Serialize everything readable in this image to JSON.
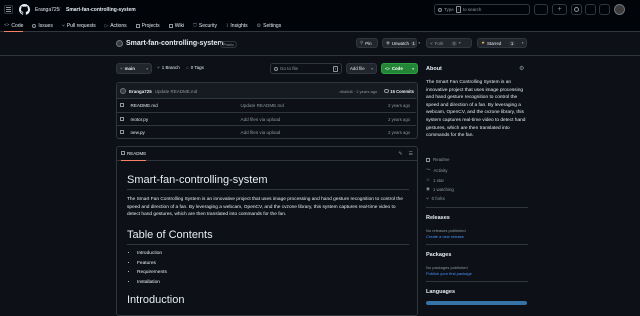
{
  "header": {
    "owner": "Eranga725",
    "separator": "/",
    "repo": "Smart-fan-controlling-system",
    "search_placeholder_prefix": "Type",
    "search_placeholder_key": "/",
    "search_placeholder_suffix": "to search"
  },
  "nav": {
    "tabs": [
      {
        "label": "Code"
      },
      {
        "label": "Issues"
      },
      {
        "label": "Pull requests"
      },
      {
        "label": "Actions"
      },
      {
        "label": "Projects"
      },
      {
        "label": "Wiki"
      },
      {
        "label": "Security"
      },
      {
        "label": "Insights"
      },
      {
        "label": "Settings"
      }
    ]
  },
  "repo": {
    "name": "Smart-fan-controlling-system",
    "visibility": "Public",
    "pin": "Pin",
    "unwatch": "Unwatch",
    "unwatch_count": "1",
    "fork": "Fork",
    "fork_count": "0",
    "starred": "Starred",
    "star_count": "1"
  },
  "toolbar": {
    "branch": "main",
    "branches": "1 Branch",
    "tags": "0 Tags",
    "goto_placeholder": "Go to file",
    "goto_key": "t",
    "add_file": "Add file",
    "code": "Code"
  },
  "commit": {
    "author": "Eranga725",
    "message": "Update README.md",
    "hash": "d6d6d6 · 2 years ago",
    "commits": "15 Commits"
  },
  "files": [
    {
      "name": "README.md",
      "message": "Update README.md",
      "age": "2 years ago"
    },
    {
      "name": "motor.py",
      "message": "Add files via upload",
      "age": "2 years ago"
    },
    {
      "name": "new.py",
      "message": "Add files via upload",
      "age": "2 years ago"
    }
  ],
  "readme": {
    "tab": "README",
    "title": "Smart-fan-controlling-system",
    "intro": "The Smart Fan Controlling System is an innovative project that uses image processing and hand gesture recognition to control the speed and direction of a fan. By leveraging a webcam, OpenCV, and the cvzone library, this system captures real-time video to detect hand gestures, which are then translated into commands for the fan.",
    "toc_heading": "Table of Contents",
    "toc": [
      "Introduction",
      "Features",
      "Requirements",
      "Installation"
    ],
    "next_heading": "Introduction"
  },
  "about": {
    "heading": "About",
    "description": "The Smart Fan Controlling System is an innovative project that uses image processing and hand gesture recognition to control the speed and direction of a fan. By leveraging a webcam, OpenCV, and the cvzone library, this system captures real-time video to detect hand gestures, which are then translated into commands for the fan.",
    "links": [
      {
        "label": "Readme",
        "icon": "book-icon"
      },
      {
        "label": "Activity",
        "icon": "pulse-icon"
      },
      {
        "label": "1 star",
        "icon": "star-icon"
      },
      {
        "label": "1 watching",
        "icon": "eye-icon"
      },
      {
        "label": "0 forks",
        "icon": "fork-icon"
      }
    ]
  },
  "releases": {
    "heading": "Releases",
    "none": "No releases published",
    "link": "Create a new release"
  },
  "packages": {
    "heading": "Packages",
    "none": "No packages published",
    "link": "Publish your first package"
  },
  "languages": {
    "heading": "Languages",
    "bar_color": "#3572A5"
  },
  "colors": {
    "accent": "#238636",
    "link": "#4493f8",
    "underline": "#f78166",
    "star": "#e3b341"
  }
}
